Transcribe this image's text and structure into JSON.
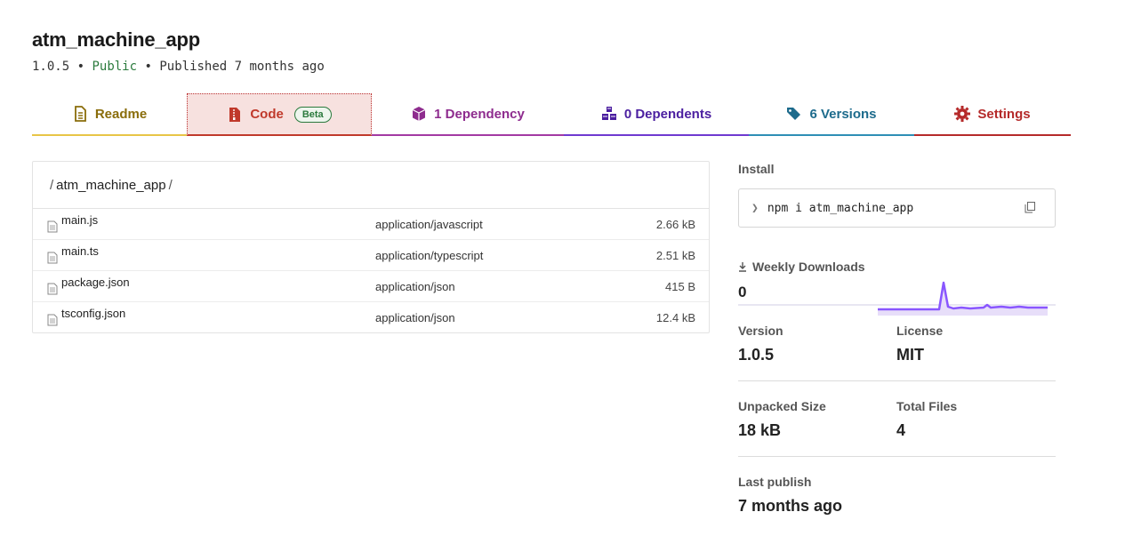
{
  "package": {
    "name": "atm_machine_app",
    "version": "1.0.5",
    "visibility": "Public",
    "published": "Published 7 months ago",
    "bullet": "•"
  },
  "tabs": [
    {
      "label": "Readme",
      "icon": "readme-icon",
      "color": "#8a6d0b"
    },
    {
      "label": "Code",
      "badge": "Beta",
      "icon": "code-file-icon",
      "color": "#c0392b"
    },
    {
      "label": "1 Dependency",
      "icon": "box-icon",
      "color": "#8e2c8e"
    },
    {
      "label": "0 Dependents",
      "icon": "boxes-icon",
      "color": "#4b1fa0"
    },
    {
      "label": "6 Versions",
      "icon": "tags-icon",
      "color": "#1d6b8c"
    },
    {
      "label": "Settings",
      "icon": "gear-icon",
      "color": "#b52a2a"
    }
  ],
  "breadcrumb": {
    "path": "atm_machine_app",
    "sep": "/"
  },
  "files": [
    {
      "name": "main.js",
      "type": "application/javascript",
      "size": "2.66 kB"
    },
    {
      "name": "main.ts",
      "type": "application/typescript",
      "size": "2.51 kB"
    },
    {
      "name": "package.json",
      "type": "application/json",
      "size": "415 B"
    },
    {
      "name": "tsconfig.json",
      "type": "application/json",
      "size": "12.4 kB"
    }
  ],
  "sidebar": {
    "install_label": "Install",
    "install_prompt": "❯",
    "install_cmd": "npm i atm_machine_app",
    "weekly_label": "Weekly Downloads",
    "weekly_count": "0",
    "version_label": "Version",
    "version_value": "1.0.5",
    "license_label": "License",
    "license_value": "MIT",
    "unpacked_label": "Unpacked Size",
    "unpacked_value": "18 kB",
    "files_label": "Total Files",
    "files_value": "4",
    "last_label": "Last publish",
    "last_value": "7 months ago"
  },
  "colors": {
    "sparkline": "#8956ff",
    "accent_public": "#2b7a3d"
  }
}
